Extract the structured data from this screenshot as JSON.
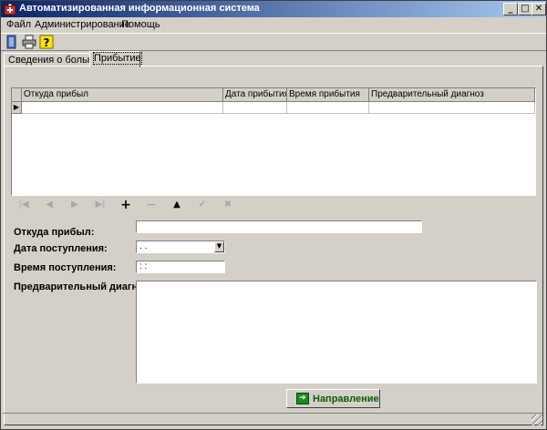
{
  "window": {
    "title": "Автоматизированная информационная система"
  },
  "caption_buttons": {
    "minimize": "_",
    "maximize": "□",
    "close": "✕"
  },
  "menu": [
    "Файл",
    "Администрирование",
    "Помощь"
  ],
  "toolbar": [
    "door-exit-icon",
    "printer-icon",
    "help-icon"
  ],
  "tabs": [
    {
      "label": "Сведения о больных",
      "active": false
    },
    {
      "label": "Прибытие",
      "active": true
    }
  ],
  "grid": {
    "columns": [
      "Откуда прибыл",
      "Дата прибытия",
      "Время прибытия",
      "Предварительный диагноз"
    ],
    "row_indicator": "▶"
  },
  "navigator": {
    "first": "|◀",
    "prior": "◀",
    "next": "▶",
    "last": "▶|",
    "insert": "+",
    "delete": "−",
    "edit": "▲",
    "post": "✔",
    "cancel": "✖"
  },
  "form": {
    "from_label": "Откуда прибыл:",
    "from_value": "",
    "date_label": "Дата поступления:",
    "date_value": " .  .",
    "time_label": "Время поступления:",
    "time_value": " :  :",
    "diag_label": "Предварительный диагноз:",
    "diag_value": ""
  },
  "direction_button": {
    "label": "Направление"
  },
  "colors": {
    "titlebar_start": "#0a246a",
    "titlebar_end": "#a6caf0",
    "button_text": "#0a5d0a"
  }
}
